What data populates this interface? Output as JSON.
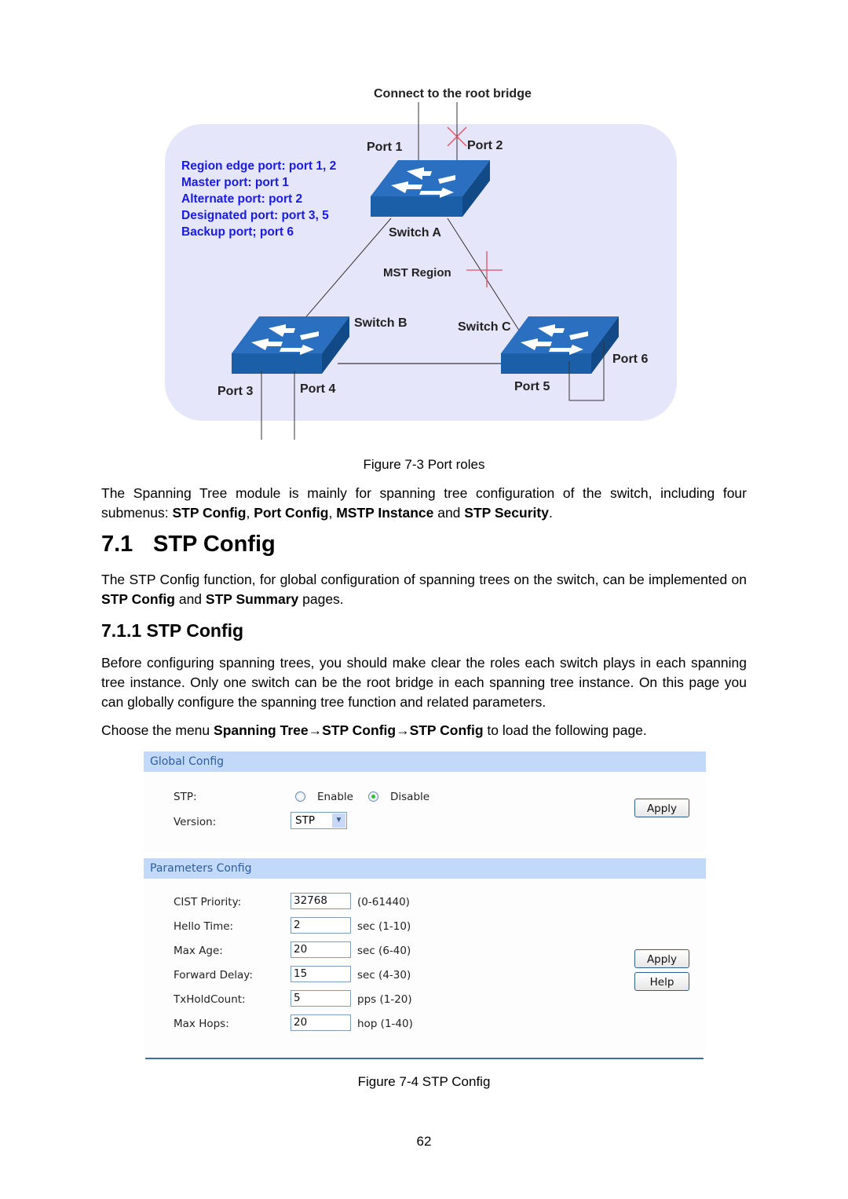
{
  "figure_7_3": {
    "top_label": "Connect to the root bridge",
    "legend": [
      "Region edge port: port 1, 2",
      "Master port: port 1",
      "Alternate port: port 2",
      "Designated port: port 3, 5",
      "Backup port; port 6"
    ],
    "port_labels": {
      "port1": "Port 1",
      "port2": "Port 2",
      "port3": "Port 3",
      "port4": "Port 4",
      "port5": "Port 5",
      "port6": "Port 6"
    },
    "switch_labels": {
      "a": "Switch A",
      "b": "Switch B",
      "c": "Switch C"
    },
    "region_label": "MST Region",
    "colors": {
      "region_bg": "#e6e6fa",
      "switch_blue": "#1a5fa8",
      "legend_blue": "#1a1ae6",
      "blocked_mark": "#e05060"
    },
    "caption": "Figure 7-3 Port roles"
  },
  "intro": {
    "text_before": "The Spanning Tree module is mainly for spanning tree configuration of the switch, including four submenus: ",
    "items": [
      "STP Config",
      "Port Config",
      "MSTP Instance",
      "STP Security"
    ],
    "sep1": ", ",
    "sep2": ", ",
    "sep3": " and ",
    "end": "."
  },
  "section_7_1": {
    "number": "7.1",
    "title": "STP Config",
    "text_before": "The STP Config function, for global configuration of spanning trees on the switch, can be implemented on ",
    "bold1": "STP Config",
    "mid": " and ",
    "bold2": "STP Summary",
    "text_after": " pages."
  },
  "section_7_1_1": {
    "heading": "7.1.1 STP Config",
    "paragraph": "Before configuring spanning trees, you should make clear the roles each switch plays in each spanning tree instance. Only one switch can be the root bridge in each spanning tree instance. On this page you can globally configure the spanning tree function and related parameters.",
    "menu_before": "Choose the menu ",
    "menu_path": "Spanning Tree→STP Config→STP Config",
    "menu_after": " to load the following page."
  },
  "stp_config_ui": {
    "global_config": {
      "title": "Global Config",
      "stp_label": "STP:",
      "stp_options": [
        "Enable",
        "Disable"
      ],
      "stp_selected": "Disable",
      "version_label": "Version:",
      "version_value": "STP",
      "apply_label": "Apply"
    },
    "parameters_config": {
      "title": "Parameters Config",
      "fields": [
        {
          "label": "CIST Priority:",
          "value": "32768",
          "hint": "(0-61440)"
        },
        {
          "label": "Hello Time:",
          "value": "2",
          "hint": "sec (1-10)"
        },
        {
          "label": "Max Age:",
          "value": "20",
          "hint": "sec (6-40)"
        },
        {
          "label": "Forward Delay:",
          "value": "15",
          "hint": "sec (4-30)"
        },
        {
          "label": "TxHoldCount:",
          "value": "5",
          "hint": "pps (1-20)"
        },
        {
          "label": "Max Hops:",
          "value": "20",
          "hint": "hop (1-40)"
        }
      ],
      "apply_label": "Apply",
      "help_label": "Help"
    },
    "colors": {
      "section_bar": "#c3d9f9",
      "section_title": "#2e5d9e",
      "rule": "#3a6ea5"
    },
    "caption": "Figure 7-4 STP Config"
  },
  "page_number": "62"
}
